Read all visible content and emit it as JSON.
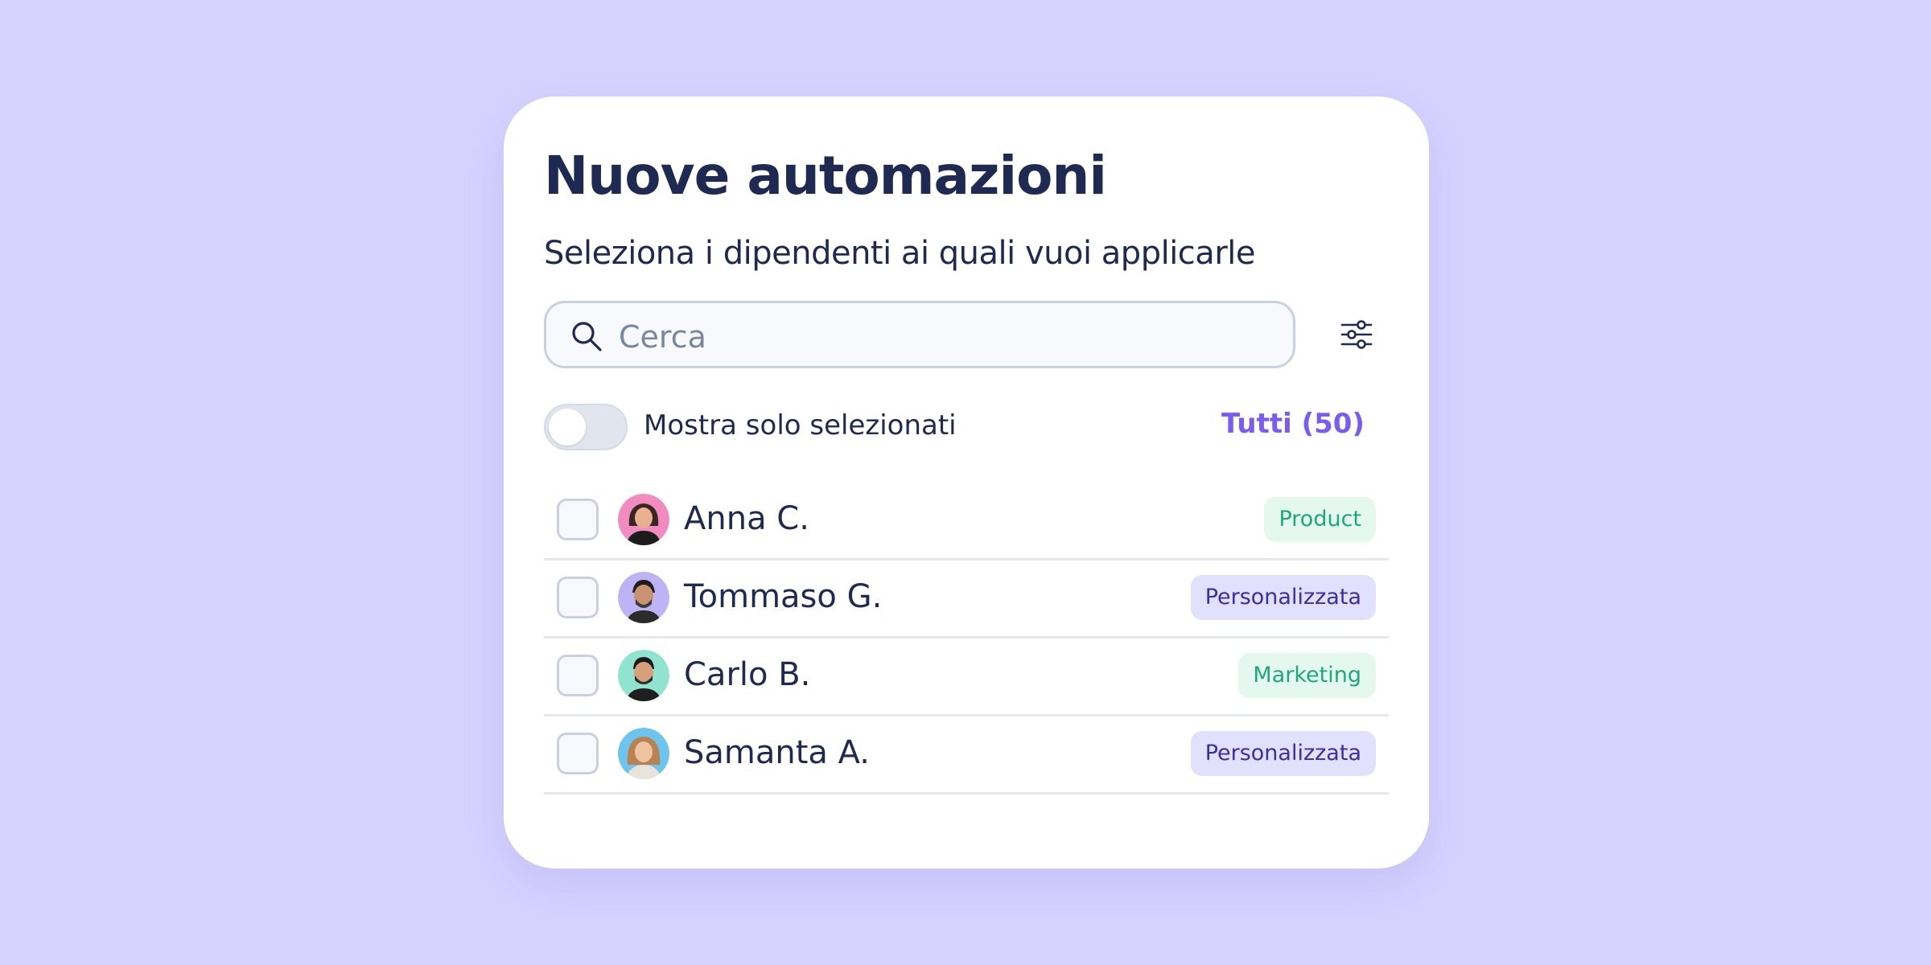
{
  "header": {
    "title": "Nuove automazioni",
    "subtitle": "Seleziona i dipendenti ai quali vuoi applicarle"
  },
  "search": {
    "placeholder": "Cerca",
    "icon": "search-icon"
  },
  "filter": {
    "icon": "sliders-icon"
  },
  "toggle": {
    "label": "Mostra solo selezionati",
    "checked": false
  },
  "all_link": "Tutti (50)",
  "colors": {
    "background": "#d5d2fe",
    "accent": "#7a5cf5",
    "text": "#1f2a52",
    "badge_green_bg": "#e4f8f0",
    "badge_green_text": "#1ea779",
    "badge_purple_bg": "#e1e0fd",
    "badge_purple_text": "#3b2fa3"
  },
  "employees": [
    {
      "name": "Anna C.",
      "tag": "Product",
      "tag_color": "green",
      "checked": false
    },
    {
      "name": "Tommaso G.",
      "tag": "Personalizzata",
      "tag_color": "purple",
      "checked": false
    },
    {
      "name": "Carlo B.",
      "tag": "Marketing",
      "tag_color": "green",
      "checked": false
    },
    {
      "name": "Samanta A.",
      "tag": "Personalizzata",
      "tag_color": "purple",
      "checked": false
    }
  ]
}
